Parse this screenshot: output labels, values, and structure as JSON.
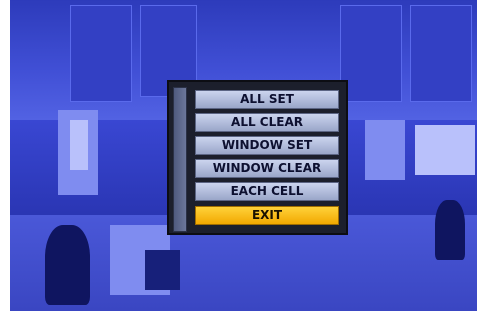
{
  "menu": {
    "items": [
      {
        "label": "ALL SET"
      },
      {
        "label": "ALL CLEAR"
      },
      {
        "label": "WINDOW SET"
      },
      {
        "label": "WINDOW CLEAR"
      },
      {
        "label": "EACH CELL"
      },
      {
        "label": "EXIT",
        "selected": true
      }
    ]
  },
  "colors": {
    "overlay_tint": "#3b49d6",
    "selected_item": "#f2a800",
    "menu_item": "#b0bbdc"
  }
}
